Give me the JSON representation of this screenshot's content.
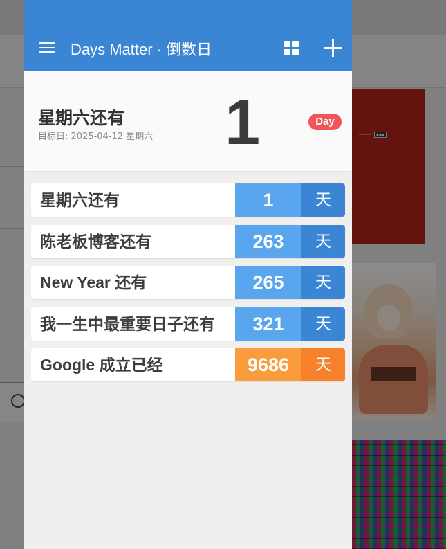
{
  "colors": {
    "appbar": "#3a86d4",
    "badge": "#f0555a",
    "future_num": "#5aa6ee",
    "future_unit": "#3a86d4",
    "past_num": "#fb9c3c",
    "past_unit": "#f7812a"
  },
  "appbar": {
    "title": "Days Matter · 倒数日",
    "menu_icon": "hamburger-icon",
    "grid_icon": "grid-icon",
    "add_icon": "plus-icon"
  },
  "hero": {
    "title": "星期六还有",
    "subtitle": "目标日: 2025-04-12 星期六",
    "number": "1",
    "badge": "Day"
  },
  "items": [
    {
      "label": "星期六还有",
      "number": "1",
      "unit": "天",
      "kind": "future"
    },
    {
      "label": "陈老板博客还有",
      "number": "263",
      "unit": "天",
      "kind": "future"
    },
    {
      "label": "New Year 还有",
      "number": "265",
      "unit": "天",
      "kind": "future"
    },
    {
      "label": "我一生中最重要日子还有",
      "number": "321",
      "unit": "天",
      "kind": "future"
    },
    {
      "label": "Google 成立已经",
      "number": "9686",
      "unit": "天",
      "kind": "past"
    }
  ]
}
